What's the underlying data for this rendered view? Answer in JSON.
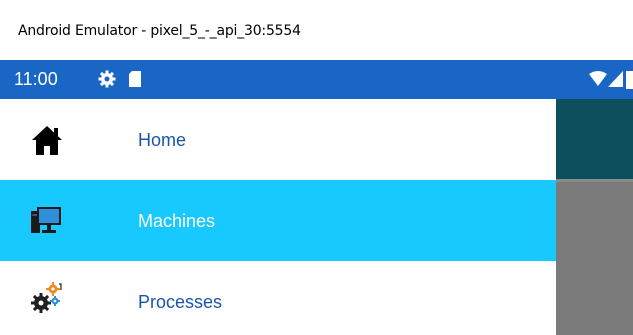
{
  "window": {
    "title": "Android Emulator - pixel_5_-_api_30:5554"
  },
  "statusbar": {
    "time": "11:00",
    "icons": [
      "gear-icon",
      "sd-card-icon",
      "wifi-icon",
      "signal-icon",
      "battery-icon"
    ],
    "color": "#1a66c5"
  },
  "drawer": {
    "items": [
      {
        "label": "Home",
        "icon": "home-icon",
        "selected": false
      },
      {
        "label": "Machines",
        "icon": "computer-icon",
        "selected": true
      },
      {
        "label": "Processes",
        "icon": "gears-icon",
        "selected": false
      }
    ],
    "selected_color": "#17c9ff",
    "label_color": "#1a56a8"
  },
  "scrim": {
    "appbar_color": "#0e4f5e"
  }
}
